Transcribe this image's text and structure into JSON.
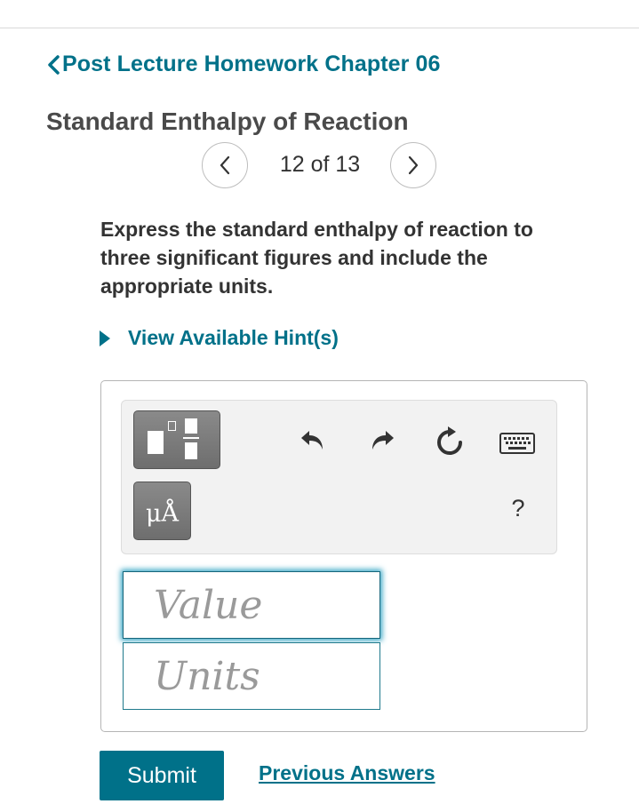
{
  "breadcrumb": {
    "back_label": "Post Lecture Homework Chapter 06"
  },
  "header": {
    "title": "Standard Enthalpy of Reaction"
  },
  "pager": {
    "text": "12 of 13"
  },
  "question": {
    "instructions": "Express the standard enthalpy of reaction to three significant figures and include the appropriate units.",
    "hint_label": "View Available Hint(s)"
  },
  "toolbar": {
    "unit_label": "μÅ",
    "help_label": "?",
    "icons": [
      "templates-icon",
      "units-icon",
      "undo-icon",
      "redo-icon",
      "reset-icon",
      "keyboard-icon",
      "help-icon"
    ]
  },
  "answer": {
    "value_placeholder": "Value",
    "units_placeholder": "Units"
  },
  "actions": {
    "submit_label": "Submit",
    "previous_answers_label": "Previous Answers"
  },
  "colors": {
    "accent": "#007189",
    "focus_glow": "#33a4c4",
    "tool_button": "#7a7a7a"
  }
}
